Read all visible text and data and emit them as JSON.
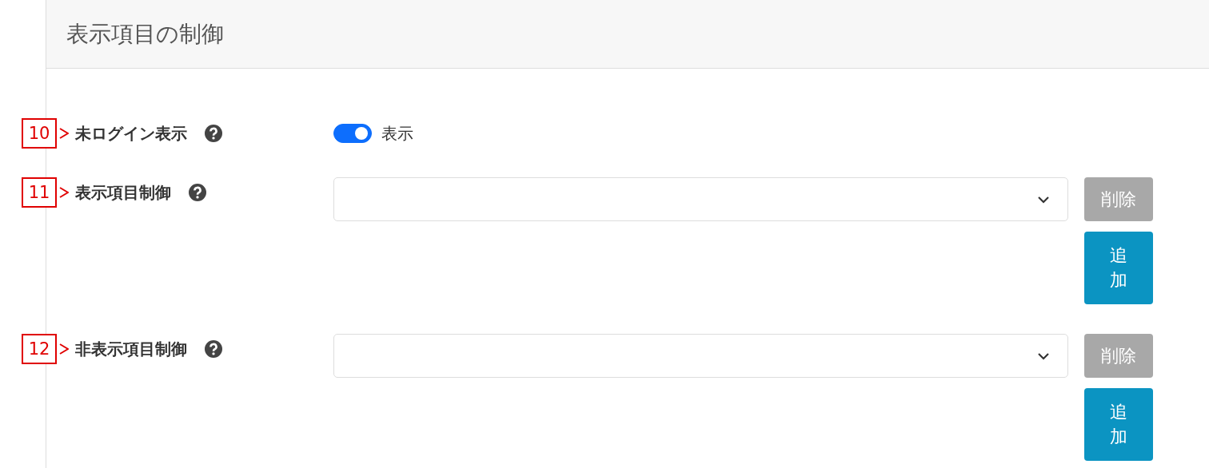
{
  "section_title": "表示項目の制御",
  "rows": [
    {
      "callout": "10",
      "label": "未ログイン表示",
      "kind": "toggle",
      "toggle": {
        "on": true,
        "label": "表示"
      }
    },
    {
      "callout": "11",
      "label": "表示項目制御",
      "kind": "select",
      "delete_button": {
        "label": "削除",
        "disabled": true
      },
      "add_button": {
        "label": "追加"
      }
    },
    {
      "callout": "12",
      "label": "非表示項目制御",
      "kind": "select",
      "delete_button": {
        "label": "削除",
        "disabled": true
      },
      "add_button": {
        "label": "追加"
      }
    }
  ]
}
